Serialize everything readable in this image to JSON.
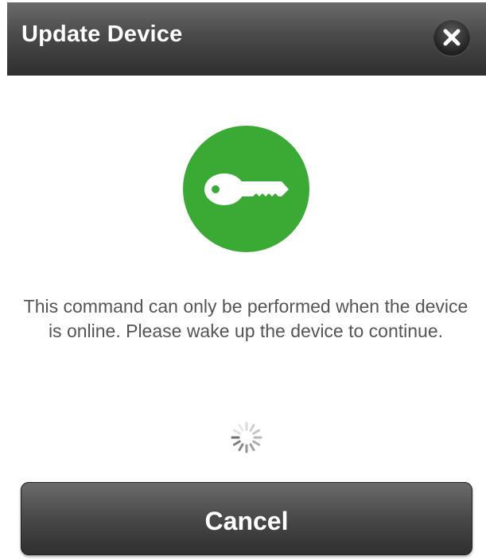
{
  "dialog": {
    "title": "Update Device",
    "close_icon": "close-icon",
    "icon": "key-icon",
    "icon_color": "#3aaa35",
    "message": "This command can only be performed when the device is online. Please wake up the device to continue.",
    "loading_indicator": "spinner-icon",
    "cancel_label": "Cancel"
  }
}
